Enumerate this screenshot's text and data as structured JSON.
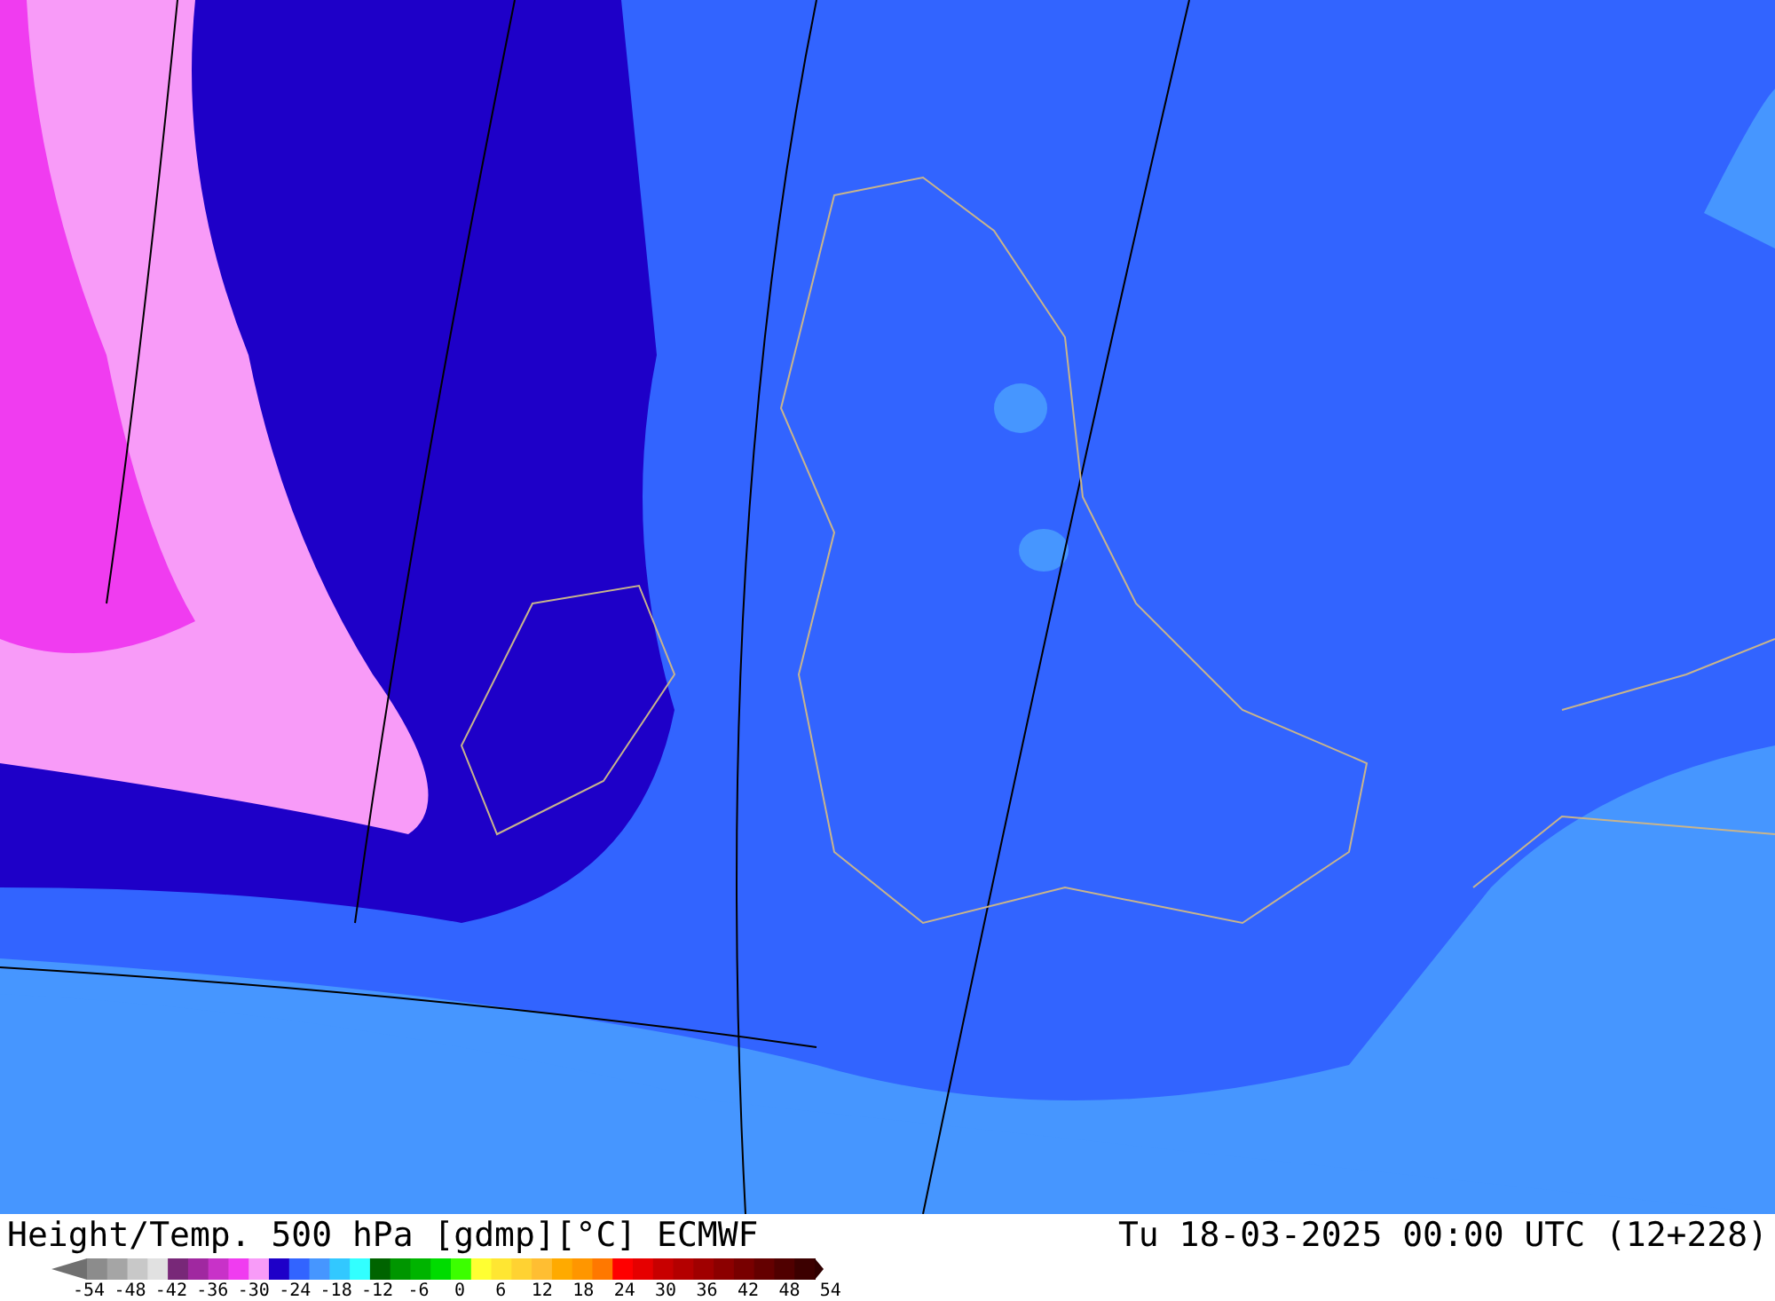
{
  "footer": {
    "title": "Height/Temp. 500 hPa [gdmp][°C] ECMWF",
    "valid_time": "Tu 18-03-2025 00:00 UTC (12+228)",
    "legend_ticks": [
      "-54",
      "-48",
      "-42",
      "-36",
      "-30",
      "-24",
      "-18",
      "-12",
      "-6",
      "0",
      "6",
      "12",
      "18",
      "24",
      "30",
      "36",
      "42",
      "48",
      "54"
    ]
  }
}
